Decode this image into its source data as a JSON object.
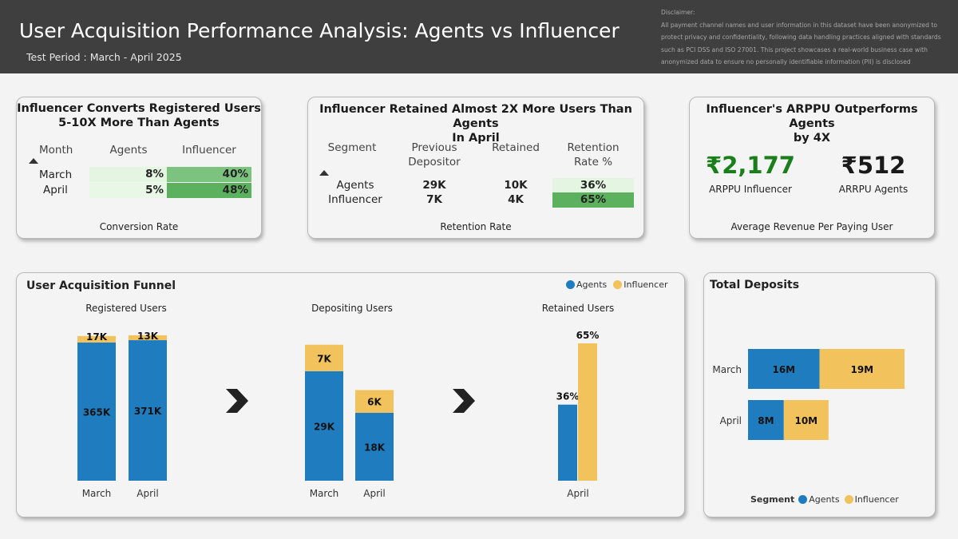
{
  "header": {
    "title": "User Acquisition Performance Analysis: Agents vs Influencer",
    "subtitle": "Test Period : March - April 2025",
    "disclaimer_lines": [
      "Disclaimer:",
      "All payment channel names and user information in this dataset have been anonymized to",
      "protect privacy and confidentiality, following data handling practices aligned with standards",
      "such as PCI DSS and ISO 27001. This project showcases a real-world business case with",
      "anonymized data to ensure no personally identifiable information (PII) is disclosed"
    ]
  },
  "colors": {
    "agents": "#1f7dbf",
    "influencer": "#f2c35c",
    "green_text": "#1a7f1a",
    "header_bg": "#3f3f3f"
  },
  "conversion": {
    "title_l1": "Influencer Converts Registered Users",
    "title_l2": "5-10X More Than Agents",
    "columns": [
      "Month",
      "Agents",
      "Influencer"
    ],
    "rows": [
      {
        "month": "March",
        "agents": "8%",
        "influencer": "40%"
      },
      {
        "month": "April",
        "agents": "5%",
        "influencer": "48%"
      }
    ],
    "caption": "Conversion Rate"
  },
  "retention": {
    "title_l1": "Influencer Retained Almost 2X More Users Than Agents",
    "title_l2": "In April",
    "columns": [
      {
        "l1": "Segment",
        "l2": ""
      },
      {
        "l1": "Previous",
        "l2": "Depositor"
      },
      {
        "l1": "Retained",
        "l2": ""
      },
      {
        "l1": "Retention",
        "l2": "Rate %"
      }
    ],
    "rows": [
      {
        "segment": "Agents",
        "previous": "29K",
        "retained": "10K",
        "rate": "36%"
      },
      {
        "segment": "Influencer",
        "previous": "7K",
        "retained": "4K",
        "rate": "65%"
      }
    ],
    "caption": "Retention Rate"
  },
  "arppu": {
    "title_l1": "Influencer's ARPPU Outperforms Agents",
    "title_l2": "by 4X",
    "influencer_value": "₹2,177",
    "influencer_label": "ARPPU Influencer",
    "agents_value": "₹512",
    "agents_label": "ARRPU Agents",
    "caption": "Average Revenue Per Paying User"
  },
  "funnel": {
    "title": "User Acquisition Funnel",
    "legend": [
      "Agents",
      "Influencer"
    ]
  },
  "deposits": {
    "title": "Total Deposits",
    "legend_title": "Segment",
    "legend": [
      "Agents",
      "Influencer"
    ]
  },
  "chart_data": [
    {
      "type": "bar",
      "title": "Registered Users",
      "stacked": true,
      "categories": [
        "March",
        "April"
      ],
      "series": [
        {
          "name": "Agents",
          "values": [
            365,
            371
          ],
          "labels": [
            "365K",
            "371K"
          ]
        },
        {
          "name": "Influencer",
          "values": [
            17,
            13
          ],
          "labels": [
            "17K",
            "13K"
          ]
        }
      ]
    },
    {
      "type": "bar",
      "title": "Depositing Users",
      "stacked": true,
      "categories": [
        "March",
        "April"
      ],
      "series": [
        {
          "name": "Agents",
          "values": [
            29,
            18
          ],
          "labels": [
            "29K",
            "18K"
          ]
        },
        {
          "name": "Influencer",
          "values": [
            7,
            6
          ],
          "labels": [
            "7K",
            "6K"
          ]
        }
      ]
    },
    {
      "type": "bar",
      "title": "Retained Users",
      "stacked": false,
      "categories": [
        "April"
      ],
      "series": [
        {
          "name": "Agents",
          "values": [
            36
          ],
          "labels": [
            "36%"
          ]
        },
        {
          "name": "Influencer",
          "values": [
            65
          ],
          "labels": [
            "65%"
          ]
        }
      ]
    },
    {
      "type": "bar",
      "orientation": "horizontal",
      "title": "Total Deposits",
      "stacked": true,
      "categories": [
        "March",
        "April"
      ],
      "series": [
        {
          "name": "Agents",
          "values": [
            16,
            8
          ],
          "labels": [
            "16M",
            "8M"
          ]
        },
        {
          "name": "Influencer",
          "values": [
            19,
            10
          ],
          "labels": [
            "19M",
            "10M"
          ]
        }
      ]
    }
  ]
}
